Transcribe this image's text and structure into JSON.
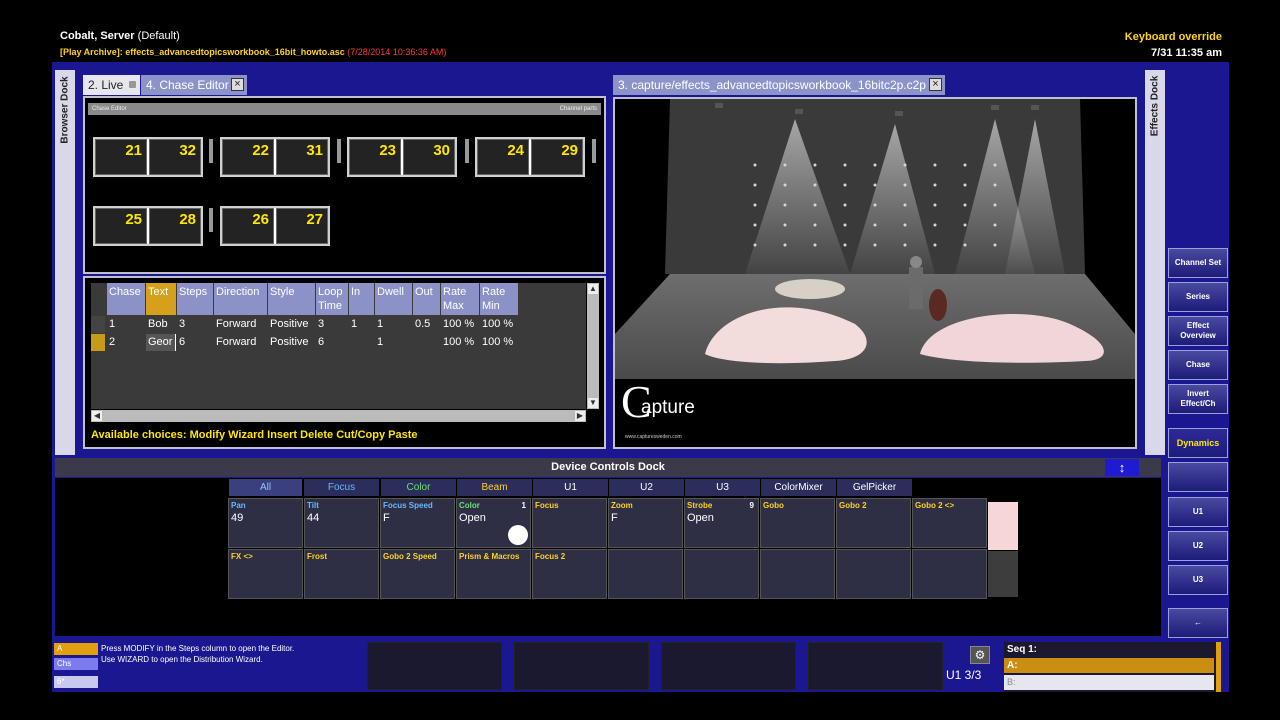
{
  "header": {
    "title": "Cobalt, Server",
    "title_suffix": "(Default)",
    "archive_label": "[Play Archive]: effects_advancedtopicsworkbook_16bit_howto.asc",
    "archive_timestamp": "(7/28/2014 10:36:36 AM)",
    "keyboard_override": "Keyboard override",
    "datetime": "7/31 11:35 am"
  },
  "docks": {
    "browser": "Browser Dock",
    "effects": "Effects Dock"
  },
  "tabs": [
    {
      "label": "2. Live"
    },
    {
      "label": "4. Chase Editor",
      "close": "×"
    },
    {
      "label": "3. capture/effects_advancedtopicsworkbook_16bitc2p.c2p",
      "close": "×"
    }
  ],
  "chase_editor": {
    "strip_left": "Chase Editor",
    "strip_right": "Channel parts",
    "boxes": [
      [
        "21",
        "32"
      ],
      [
        "22",
        "31"
      ],
      [
        "23",
        "30"
      ],
      [
        "24",
        "29"
      ],
      [
        "25",
        "28"
      ],
      [
        "26",
        "27"
      ]
    ]
  },
  "chase_table": {
    "headers": [
      "Chase",
      "Text",
      "Steps",
      "Direction",
      "Style",
      "Loop Time",
      "In",
      "Dwell",
      "Out",
      "Rate Max",
      "Rate Min"
    ],
    "rows": [
      [
        "1",
        "Bob",
        "3",
        "Forward",
        "Positive",
        "3",
        "1",
        "1",
        "0.5",
        "100 %",
        "100 %"
      ],
      [
        "2",
        "Geor",
        "6",
        "Forward",
        "Positive",
        "6",
        "",
        "1",
        "",
        "100 %",
        "100 %"
      ]
    ],
    "choices": "Available choices: Modify Wizard Insert Delete Cut/Copy Paste"
  },
  "capture": {
    "logo": "apture",
    "logo_initial": "C",
    "url": "www.capturesweden.com"
  },
  "right_buttons": [
    "Channel Set",
    "Series",
    "Effect Overview",
    "Chase",
    "Invert Effect/Ch",
    "Dynamics",
    "",
    "U1",
    "U2",
    "U3",
    "←"
  ],
  "device_controls": {
    "title": "Device Controls Dock",
    "arrow": "↕",
    "categories": [
      "All",
      "Focus",
      "Color",
      "Beam",
      "U1",
      "U2",
      "U3",
      "ColorMixer",
      "GelPicker"
    ],
    "cells_row1": [
      {
        "label": "Pan",
        "value": "49",
        "extra": ""
      },
      {
        "label": "Tilt",
        "value": "44",
        "extra": ""
      },
      {
        "label": "Focus Speed",
        "value": "F",
        "extra": ""
      },
      {
        "label": "Color",
        "value": "Open",
        "extra": "1"
      },
      {
        "label": "Focus",
        "value": "",
        "extra": ""
      },
      {
        "label": "Zoom",
        "value": "F",
        "extra": ""
      },
      {
        "label": "Strobe",
        "value": "Open",
        "extra": "9"
      },
      {
        "label": "Gobo",
        "value": "",
        "extra": ""
      },
      {
        "label": "Gobo 2",
        "value": "",
        "extra": ""
      },
      {
        "label": "Gobo 2 <>",
        "value": "",
        "extra": ""
      }
    ],
    "cells_row2": [
      {
        "label": "FX <>"
      },
      {
        "label": "Frost"
      },
      {
        "label": "Gobo 2 Speed"
      },
      {
        "label": "Prism & Macros"
      },
      {
        "label": "Focus 2"
      },
      {
        "label": ""
      },
      {
        "label": ""
      },
      {
        "label": ""
      },
      {
        "label": ""
      },
      {
        "label": ""
      }
    ]
  },
  "bottom": {
    "mini": [
      "A",
      "Chs",
      "6*"
    ],
    "hint_line1": "Press MODIFY in the Steps column to open the Editor.",
    "hint_line2": "Use WIZARD to open the Distribution Wizard.",
    "universe": "U1 3/3",
    "seq_title": "Seq 1:",
    "seq_a": "A:",
    "seq_b": "B:"
  },
  "colors": {
    "frame_blue": "#1a1790",
    "accent_yellow": "#ffe600",
    "selected_header": "#d6a01d"
  }
}
